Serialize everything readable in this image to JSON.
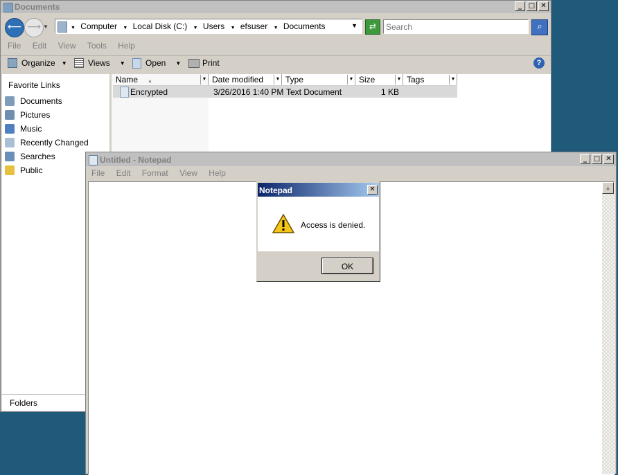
{
  "explorer": {
    "title": "Documents",
    "breadcrumb": [
      "Computer",
      "Local Disk (C:)",
      "Users",
      "efsuser",
      "Documents"
    ],
    "search_placeholder": "Search",
    "menu": [
      "File",
      "Edit",
      "View",
      "Tools",
      "Help"
    ],
    "toolbar": {
      "organize": "Organize",
      "views": "Views",
      "open": "Open",
      "print": "Print"
    },
    "favorite_links_title": "Favorite Links",
    "nav": [
      "Documents",
      "Pictures",
      "Music",
      "Recently Changed",
      "Searches",
      "Public"
    ],
    "folders_label": "Folders",
    "columns": [
      "Name",
      "Date modified",
      "Type",
      "Size",
      "Tags"
    ],
    "rows": [
      {
        "name": "Encrypted",
        "date": "3/26/2016 1:40 PM",
        "type": "Text Document",
        "size": "1 KB",
        "tags": ""
      }
    ]
  },
  "notepad": {
    "title": "Untitled - Notepad",
    "menu": [
      "File",
      "Edit",
      "Format",
      "View",
      "Help"
    ]
  },
  "dialog": {
    "title": "Notepad",
    "message": "Access is denied.",
    "ok_label": "OK"
  },
  "colors": {
    "desktop": "#1f5a7a",
    "dialog_title_start": "#0a246a",
    "dialog_title_end": "#a6caf0"
  }
}
